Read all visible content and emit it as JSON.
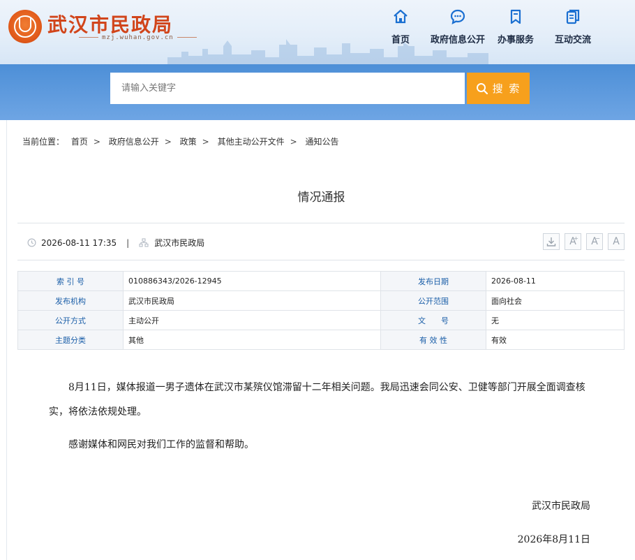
{
  "site": {
    "title": "武汉市民政局",
    "domain": "mzj.wuhan.gov.cn"
  },
  "nav": [
    {
      "label": "首页",
      "icon": "home-icon"
    },
    {
      "label": "政府信息公开",
      "icon": "chat-bubble-icon"
    },
    {
      "label": "办事服务",
      "icon": "bookmark-icon"
    },
    {
      "label": "互动交流",
      "icon": "documents-icon"
    }
  ],
  "search": {
    "placeholder": "请输入关键字",
    "button_label": "搜 索"
  },
  "breadcrumb": {
    "prefix": "当前位置：",
    "items": [
      "首页",
      "政府信息公开",
      "政策",
      "其他主动公开文件",
      "通知公告"
    ],
    "separator": ">"
  },
  "article": {
    "title": "情况通报",
    "datetime": "2026-08-11 17:35",
    "source": "武汉市民政局",
    "divider": "|",
    "tools": [
      "download-icon",
      "font-larger-icon",
      "font-medium-icon",
      "font-default-icon"
    ]
  },
  "info_table": [
    [
      {
        "key": "索 引 号",
        "value": "010886343/2026-12945"
      },
      {
        "key": "发布日期",
        "value": "2026-08-11"
      }
    ],
    [
      {
        "key": "发布机构",
        "value": "武汉市民政局"
      },
      {
        "key": "公开范围",
        "value": "面向社会"
      }
    ],
    [
      {
        "key": "公开方式",
        "value": "主动公开"
      },
      {
        "key": "文　　号",
        "value": "无"
      }
    ],
    [
      {
        "key": "主题分类",
        "value": "其他"
      },
      {
        "key": "有 效 性",
        "value": "有效"
      }
    ]
  ],
  "body": {
    "paragraphs": [
      "8月11日，媒体报道一男子遗体在武汉市某殡仪馆滞留十二年相关问题。我局迅速会同公安、卫健等部门开展全面调查核实，将依法依规处理。",
      "感谢媒体和网民对我们工作的监督和帮助。"
    ],
    "signature_org": "武汉市民政局",
    "signature_date": "2026年8月11日"
  },
  "colors": {
    "brand_red": "#d1451b",
    "nav_blue": "#1a6fd1",
    "search_band": "#5b98dd",
    "search_button": "#f7a01c",
    "table_key": "#1a5ea8"
  }
}
